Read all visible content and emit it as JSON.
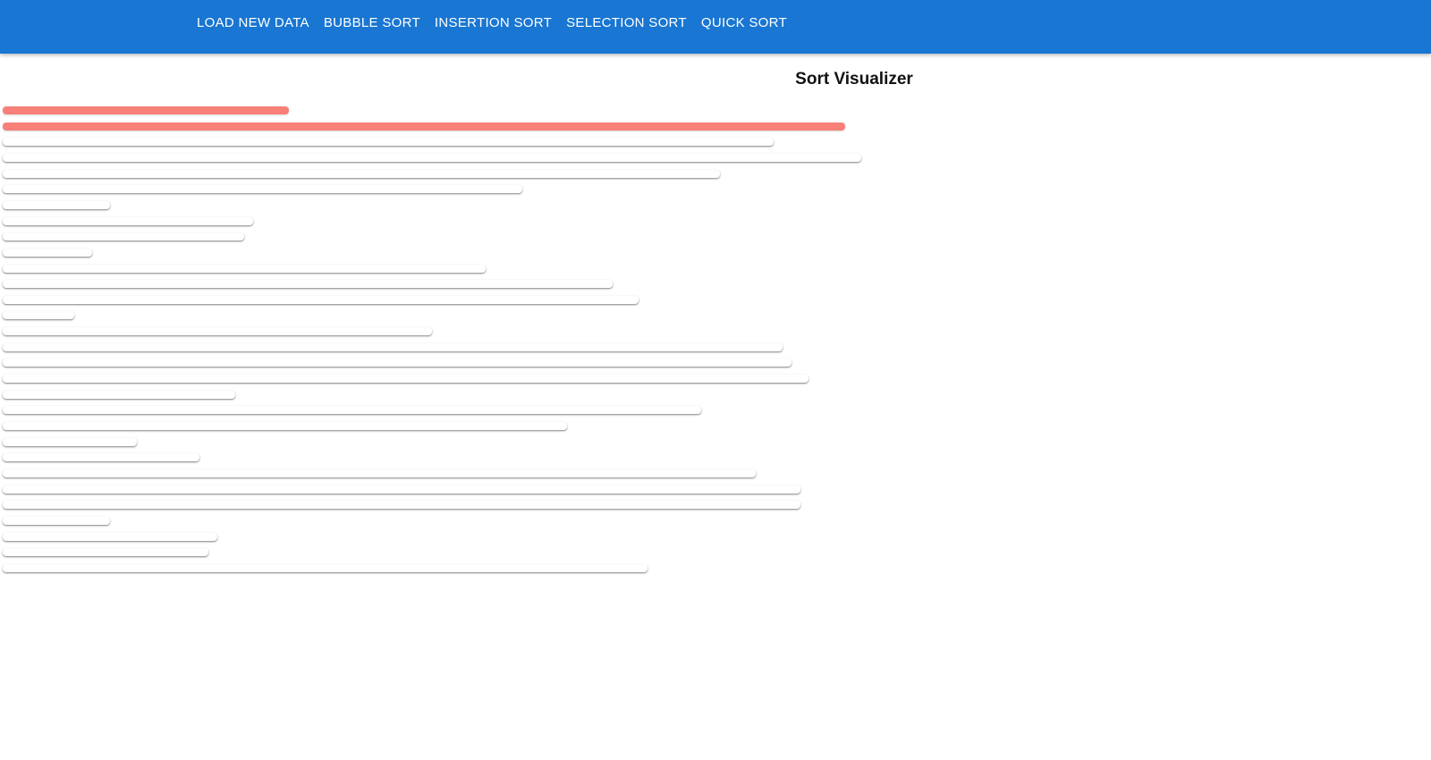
{
  "appbar": {
    "background": "#1976d2",
    "buttons": [
      {
        "id": "load-new-data",
        "label": "LOAD NEW DATA"
      },
      {
        "id": "bubble-sort",
        "label": "BUBBLE SORT"
      },
      {
        "id": "insertion-sort",
        "label": "INSERTION SORT"
      },
      {
        "id": "selection-sort",
        "label": "SELECTION SORT"
      },
      {
        "id": "quick-sort",
        "label": "QUICK SORT"
      }
    ]
  },
  "page": {
    "title": "Sort Visualizer"
  },
  "visualizer": {
    "active_color": "#f88078",
    "inactive_color": "#ffffff",
    "max_value": 100,
    "values": [
      {
        "value": 33.3,
        "active": true
      },
      {
        "value": 98.1,
        "active": true
      },
      {
        "value": 89.8,
        "active": false
      },
      {
        "value": 100.0,
        "active": false
      },
      {
        "value": 83.5,
        "active": false
      },
      {
        "value": 60.5,
        "active": false
      },
      {
        "value": 12.5,
        "active": false
      },
      {
        "value": 29.2,
        "active": false
      },
      {
        "value": 28.1,
        "active": false
      },
      {
        "value": 10.4,
        "active": false
      },
      {
        "value": 56.3,
        "active": false
      },
      {
        "value": 71.0,
        "active": false
      },
      {
        "value": 74.1,
        "active": false
      },
      {
        "value": 8.3,
        "active": false
      },
      {
        "value": 50.0,
        "active": false
      },
      {
        "value": 90.8,
        "active": false
      },
      {
        "value": 91.9,
        "active": false
      },
      {
        "value": 93.9,
        "active": false
      },
      {
        "value": 27.1,
        "active": false
      },
      {
        "value": 81.4,
        "active": false
      },
      {
        "value": 65.7,
        "active": false
      },
      {
        "value": 15.6,
        "active": false
      },
      {
        "value": 22.9,
        "active": false
      },
      {
        "value": 87.7,
        "active": false
      },
      {
        "value": 92.9,
        "active": false
      },
      {
        "value": 92.9,
        "active": false
      },
      {
        "value": 12.5,
        "active": false
      },
      {
        "value": 25.0,
        "active": false
      },
      {
        "value": 24.0,
        "active": false
      },
      {
        "value": 75.1,
        "active": false
      }
    ]
  }
}
